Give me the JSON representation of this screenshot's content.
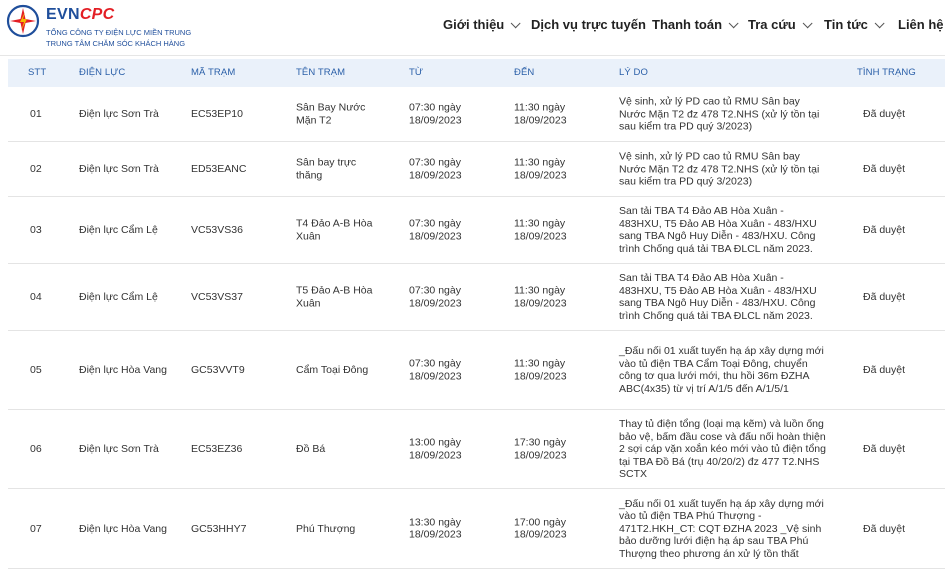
{
  "brand": {
    "name_main": "EVN",
    "name_accent": "CPC",
    "subtitle1": "TỔNG CÔNG TY ĐIỆN LỰC MIỀN TRUNG",
    "subtitle2": "TRUNG TÂM CHĂM SÓC KHÁCH HÀNG"
  },
  "nav": [
    {
      "label": "Giới thiệu",
      "dropdown": true
    },
    {
      "label": "Dịch vụ trực tuyến",
      "dropdown": false
    },
    {
      "label": "Thanh toán",
      "dropdown": true
    },
    {
      "label": "Tra cứu",
      "dropdown": true
    },
    {
      "label": "Tin tức",
      "dropdown": true
    },
    {
      "label": "Liên hệ",
      "dropdown": false
    }
  ],
  "table": {
    "headers": [
      "STT",
      "ĐIỆN LỰC",
      "MÃ TRẠM",
      "TÊN TRẠM",
      "TỪ",
      "ĐẾN",
      "LÝ DO",
      "TÌNH TRẠNG"
    ],
    "rows": [
      {
        "stt": "01",
        "dl": "Điện lực Sơn Trà",
        "ma": "EC53EP10",
        "ten": "Sân Bay Nước Mặn T2",
        "tu": "07:30 ngày 18/09/2023",
        "den": "11:30 ngày 18/09/2023",
        "lydo": "Vệ sinh, xử lý PD cao tủ RMU Sân bay Nước Mặn T2 đz 478 T2.NHS (xử lý tồn tại sau kiểm tra PD quý 3/2023)",
        "tt": "Đã duyệt"
      },
      {
        "stt": "02",
        "dl": "Điện lực Sơn Trà",
        "ma": "ED53EANC",
        "ten": "Sân bay trực thăng",
        "tu": "07:30 ngày 18/09/2023",
        "den": "11:30 ngày 18/09/2023",
        "lydo": "Vệ sinh, xử lý PD cao tủ RMU Sân bay Nước Mặn T2 đz 478 T2.NHS (xử lý tồn tại sau kiểm tra PD quý 3/2023)",
        "tt": "Đã duyệt"
      },
      {
        "stt": "03",
        "dl": "Điện lực Cẩm Lệ",
        "ma": "VC53VS36",
        "ten": "T4 Đảo A-B Hòa Xuân",
        "tu": "07:30 ngày 18/09/2023",
        "den": "11:30 ngày 18/09/2023",
        "lydo": "San tải TBA T4 Đảo AB Hòa Xuân - 483HXU, T5 Đảo AB Hòa Xuân - 483/HXU sang TBA Ngô Huy Diễn - 483/HXU. Công trình Chống quá tải TBA ĐLCL năm 2023.",
        "tt": "Đã duyệt"
      },
      {
        "stt": "04",
        "dl": "Điện lực Cẩm Lệ",
        "ma": "VC53VS37",
        "ten": "T5 Đảo A-B Hòa Xuân",
        "tu": "07:30 ngày 18/09/2023",
        "den": "11:30 ngày 18/09/2023",
        "lydo": "San tải TBA T4 Đảo AB Hòa Xuân - 483HXU, T5 Đảo AB Hòa Xuân - 483/HXU sang TBA Ngô Huy Diễn - 483/HXU. Công trình Chống quá tải TBA ĐLCL năm 2023.",
        "tt": "Đã duyệt"
      },
      {
        "stt": "05",
        "dl": "Điện lực Hòa Vang",
        "ma": "GC53VVT9",
        "ten": "Cẩm Toại Đông",
        "tu": "07:30 ngày 18/09/2023",
        "den": "11:30 ngày 18/09/2023",
        "lydo": "_Đấu nối 01 xuất tuyến hạ áp xây dựng mới vào tủ điện TBA Cẩm Toại Đông, chuyển công tơ qua lưới mới, thu hồi 36m ĐZHA ABC(4x35) từ vị trí A/1/5 đến A/1/5/1",
        "tt": "Đã duyệt"
      },
      {
        "stt": "06",
        "dl": "Điện lực Sơn Trà",
        "ma": "EC53EZ36",
        "ten": "Đồ Bá",
        "tu": "13:00 ngày 18/09/2023",
        "den": "17:30 ngày 18/09/2023",
        "lydo": "Thay tủ điện tổng (loại mạ kẽm) và luồn ống bảo vệ, bấm đầu cose và đấu nối hoàn thiện 2 sợi cáp vặn xoắn kéo mới vào tủ điện tổng tại TBA Đồ Bá (trụ 40/20/2) đz 477 T2.NHS SCTX",
        "tt": "Đã duyệt"
      },
      {
        "stt": "07",
        "dl": "Điện lực Hòa Vang",
        "ma": "GC53HHY7",
        "ten": "Phú Thượng",
        "tu": "13:30 ngày 18/09/2023",
        "den": "17:00 ngày 18/09/2023",
        "lydo": "_Đấu nối 01 xuất tuyến hạ áp xây dựng mới vào tủ điện TBA Phú Thượng - 471T2.HKH_CT: CQT ĐZHA 2023 _Vệ sinh bảo dưỡng lưới điện hạ áp sau TBA Phú Thượng theo phương án xử lý tồn thất",
        "tt": "Đã duyệt"
      }
    ]
  }
}
